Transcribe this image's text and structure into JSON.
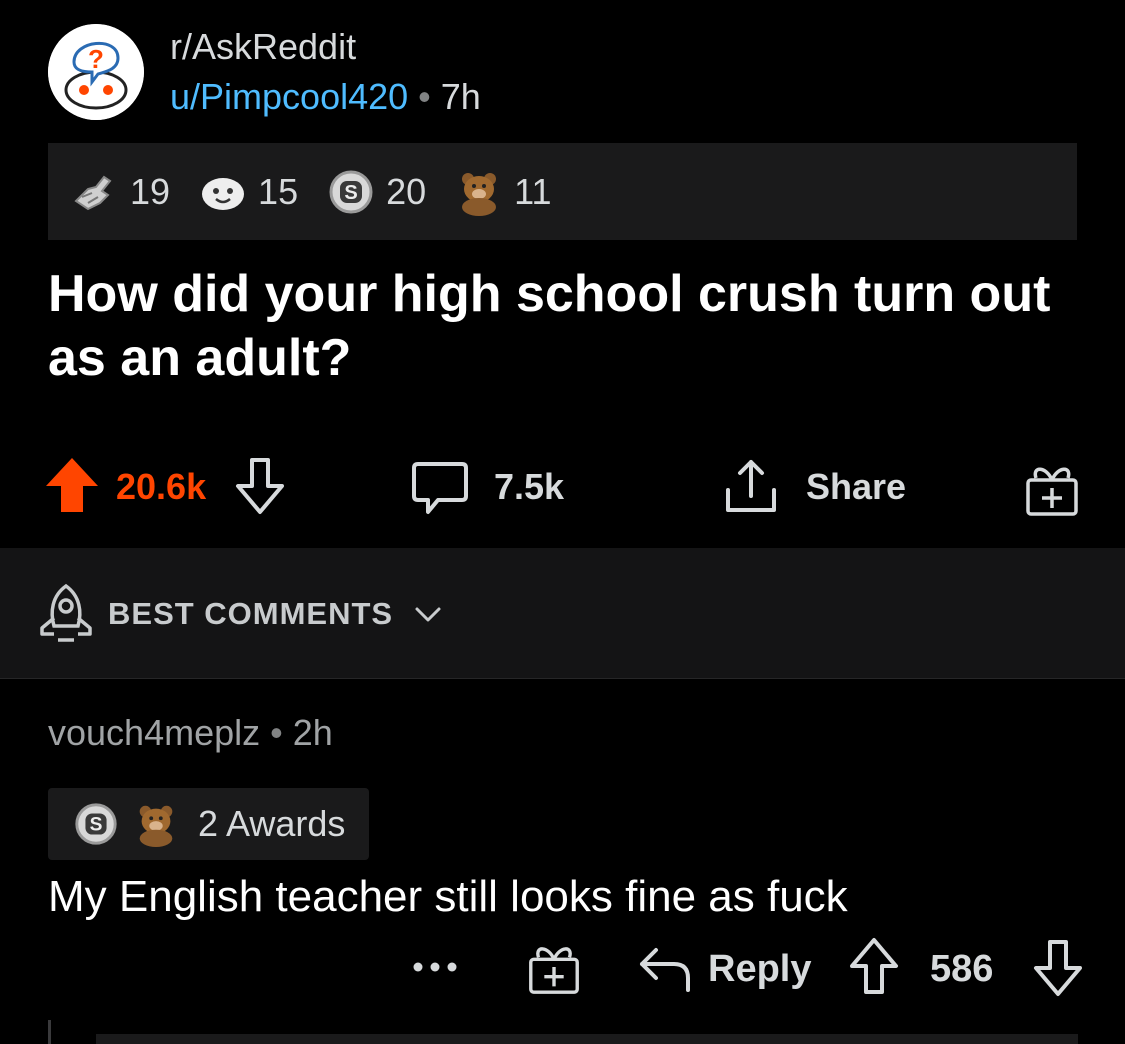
{
  "post": {
    "subreddit": "r/AskReddit",
    "author": "u/Pimpcool420",
    "separator": "•",
    "age": "7h",
    "awards": [
      {
        "icon": "helping-hand-award-icon",
        "count": "19"
      },
      {
        "icon": "wholesome-award-icon",
        "count": "15"
      },
      {
        "icon": "silver-award-icon",
        "count": "20"
      },
      {
        "icon": "bear-award-icon",
        "count": "11"
      }
    ],
    "title": "How did your high school crush turn out as an adult?",
    "score": "20.6k",
    "comments_count": "7.5k",
    "share_label": "Share"
  },
  "sort": {
    "label": "BEST COMMENTS"
  },
  "comment": {
    "author": "vouch4meplz",
    "separator": "•",
    "age": "2h",
    "awards_label": "2 Awards",
    "body": "My English teacher still looks fine as fuck",
    "reply_label": "Reply",
    "score": "586"
  },
  "colors": {
    "upvote": "#ff4500",
    "username": "#4fbcff",
    "background": "#000000",
    "panel": "#1a1a1b"
  }
}
